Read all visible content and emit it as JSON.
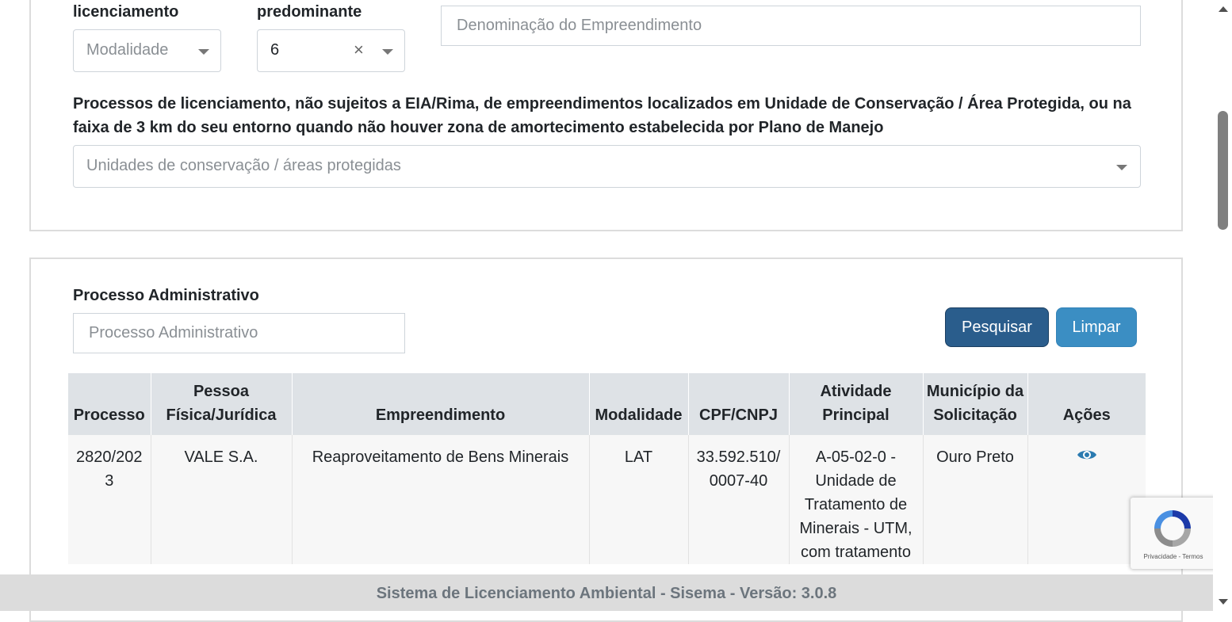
{
  "filters": {
    "modalidade_label": "licenciamento",
    "modalidade_placeholder": "Modalidade",
    "predominante_label": "predominante",
    "predominante_value": "6",
    "denominacao_placeholder": "Denominação do Empreendimento",
    "uc_description": "Processos de licenciamento, não sujeitos a EIA/Rima, de empreendimentos localizados em Unidade de Conservação / Área Protegida, ou na faixa de 3 km do seu entorno quando não houver zona de amortecimento estabelecida por Plano de Manejo",
    "uc_placeholder": "Unidades de conservação / áreas protegidas"
  },
  "search": {
    "processo_label": "Processo Administrativo",
    "processo_placeholder": "Processo Administrativo",
    "search_button": "Pesquisar",
    "clear_button": "Limpar"
  },
  "table": {
    "headers": [
      "Processo",
      "Pessoa Física/Jurídica",
      "Empreendimento",
      "Modalidade",
      "CPF/CNPJ",
      "Atividade Principal",
      "Município da Solicitação",
      "Ações"
    ],
    "rows": [
      {
        "processo": "2820/2023",
        "pessoa": "VALE S.A.",
        "empreendimento": "Reaproveitamento de Bens Minerais",
        "modalidade": "LAT",
        "cpf_cnpj": "33.592.510/0007-40",
        "atividade": "A-05-02-0 - Unidade de Tratamento de Minerais - UTM, com tratamento",
        "municipio": "Ouro Preto",
        "action_icon": "eye-icon"
      }
    ]
  },
  "recaptcha": {
    "links": "Privacidade - Termos"
  },
  "footer": {
    "text": "Sistema de Licenciamento Ambiental - Sisema - Versão: 3.0.8"
  },
  "colors": {
    "primary": "#2a5d8c",
    "info": "#3b8ec3",
    "header_bg": "#dee2e6",
    "footer_bg": "#dcdcdc"
  }
}
